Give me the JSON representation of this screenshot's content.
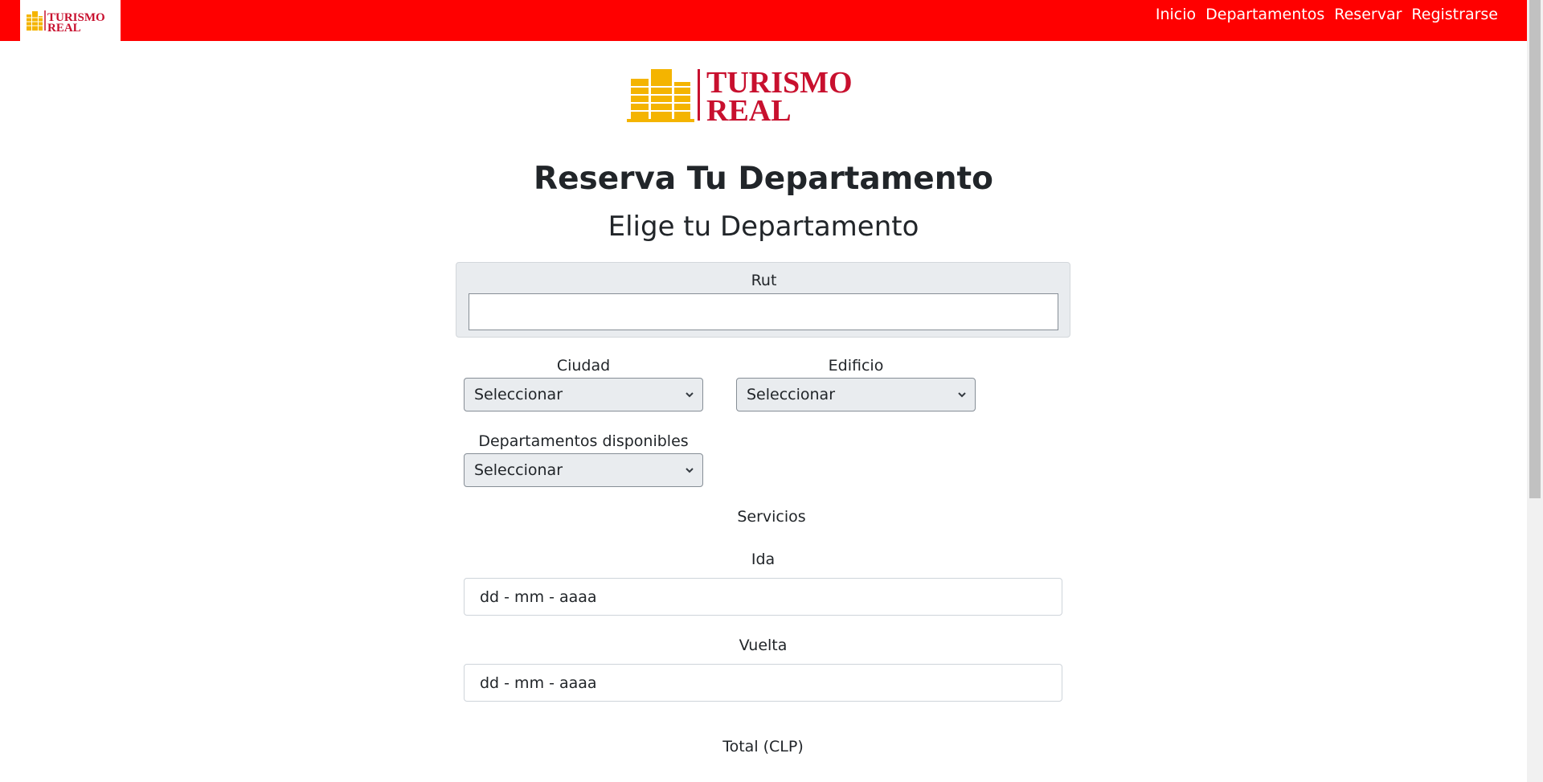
{
  "navbar": {
    "logo_text": [
      "TURISMO",
      "REAL"
    ],
    "links": [
      "Inicio",
      "Departamentos",
      "Reservar",
      "Registrarse"
    ]
  },
  "brand": {
    "logo_text": [
      "TURISMO",
      "REAL"
    ]
  },
  "page": {
    "title": "Reserva Tu Departamento",
    "subtitle": "Elige tu Departamento"
  },
  "form": {
    "rut_label": "Rut",
    "rut_value": "",
    "ciudad_label": "Ciudad",
    "ciudad_value": "Seleccionar",
    "edificio_label": "Edificio",
    "edificio_value": "Seleccionar",
    "departamentos_label": "Departamentos disponibles",
    "departamentos_value": "Seleccionar",
    "servicios_label": "Servicios",
    "ida_label": "Ida",
    "ida_placeholder": "dd - mm - aaaa",
    "vuelta_label": "Vuelta",
    "vuelta_placeholder": "dd - mm - aaaa",
    "total_label": "Total (CLP)"
  },
  "colors": {
    "navbar_bg": "#ff0000",
    "logo_red": "#c8102e",
    "logo_building": "#f4b400"
  }
}
